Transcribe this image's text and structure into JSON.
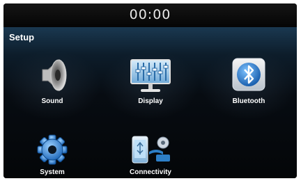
{
  "status": {
    "clock": "00:00"
  },
  "page": {
    "title": "Setup"
  },
  "menu": [
    {
      "label": "Sound",
      "icon": "speaker-icon"
    },
    {
      "label": "Display",
      "icon": "display-icon"
    },
    {
      "label": "Bluetooth",
      "icon": "bluetooth-icon"
    },
    {
      "label": "System",
      "icon": "gear-icon"
    },
    {
      "label": "Connectivity",
      "icon": "connectivity-icon"
    }
  ],
  "colors": {
    "background": "#000000",
    "text": "#ffffff",
    "accent": "#2d7fc7"
  }
}
